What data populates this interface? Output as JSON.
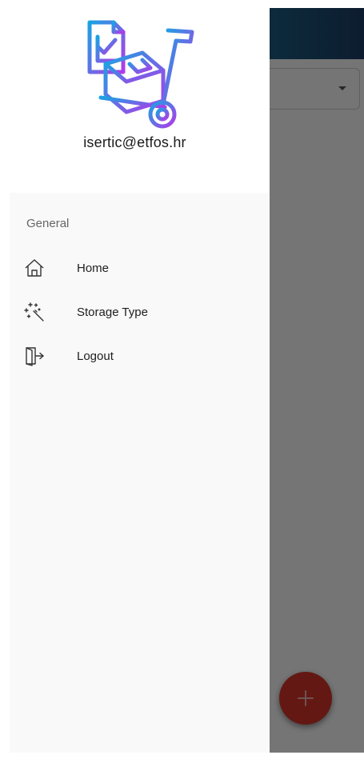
{
  "account": {
    "email": "isertic@etfos.hr"
  },
  "menu": {
    "section_label": "General",
    "items": [
      {
        "label": "Home",
        "icon": "home-icon"
      },
      {
        "label": "Storage Type",
        "icon": "magic-wand-icon"
      },
      {
        "label": "Logout",
        "icon": "logout-icon"
      }
    ]
  },
  "fab": {
    "icon": "plus-icon"
  },
  "colors": {
    "app_bar_start": "#1c5e84",
    "app_bar_end": "#1d3f66",
    "fab": "#d8352c",
    "logo_gradient_start": "#1aa3e3",
    "logo_gradient_end": "#b03ae8"
  }
}
